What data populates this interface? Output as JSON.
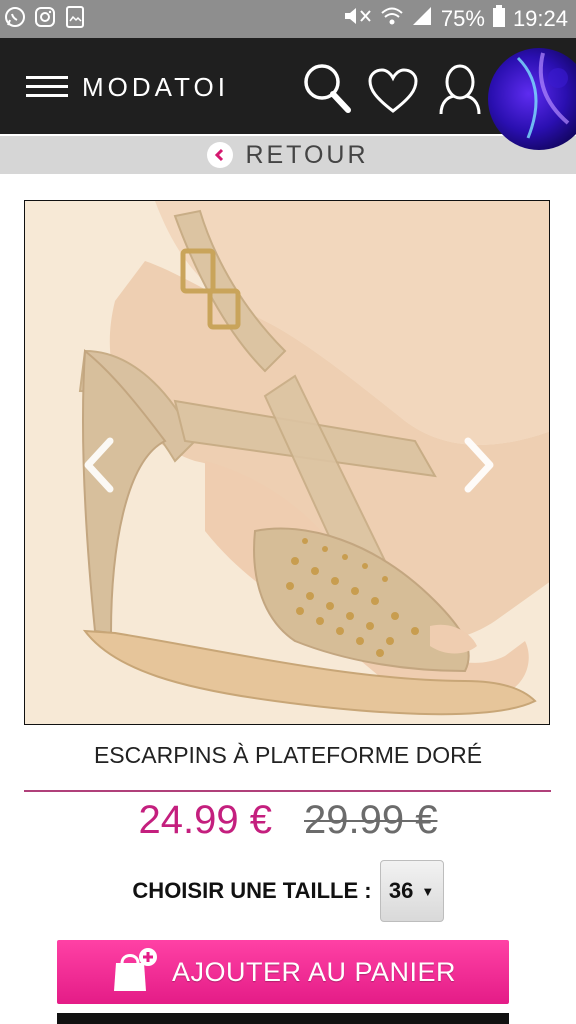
{
  "status_bar": {
    "battery": "75%",
    "time": "19:24",
    "left_icons": [
      "whatsapp-icon",
      "instagram-icon",
      "gallery-icon"
    ],
    "right_icons": [
      "mute-icon",
      "wifi-icon",
      "signal-icon",
      "battery-icon"
    ]
  },
  "header": {
    "brand": "MODATOI",
    "icons": [
      "menu-icon",
      "search-icon",
      "heart-icon",
      "account-icon"
    ],
    "background": "#1f1f1f"
  },
  "nav": {
    "back_label": "RETOUR"
  },
  "product": {
    "title": "ESCARPINS À PLATEFORME DORÉ",
    "price": "24.99 €",
    "old_price": "29.99 €",
    "size_label": "CHOISIR UNE TAILLE :",
    "size_value": "36",
    "add_to_cart": "AJOUTER AU PANIER",
    "image_alt_icon": "shoe-image"
  },
  "colors": {
    "accent": "#c41f7e",
    "button": "#e91e8a",
    "divider": "#b0407a"
  }
}
